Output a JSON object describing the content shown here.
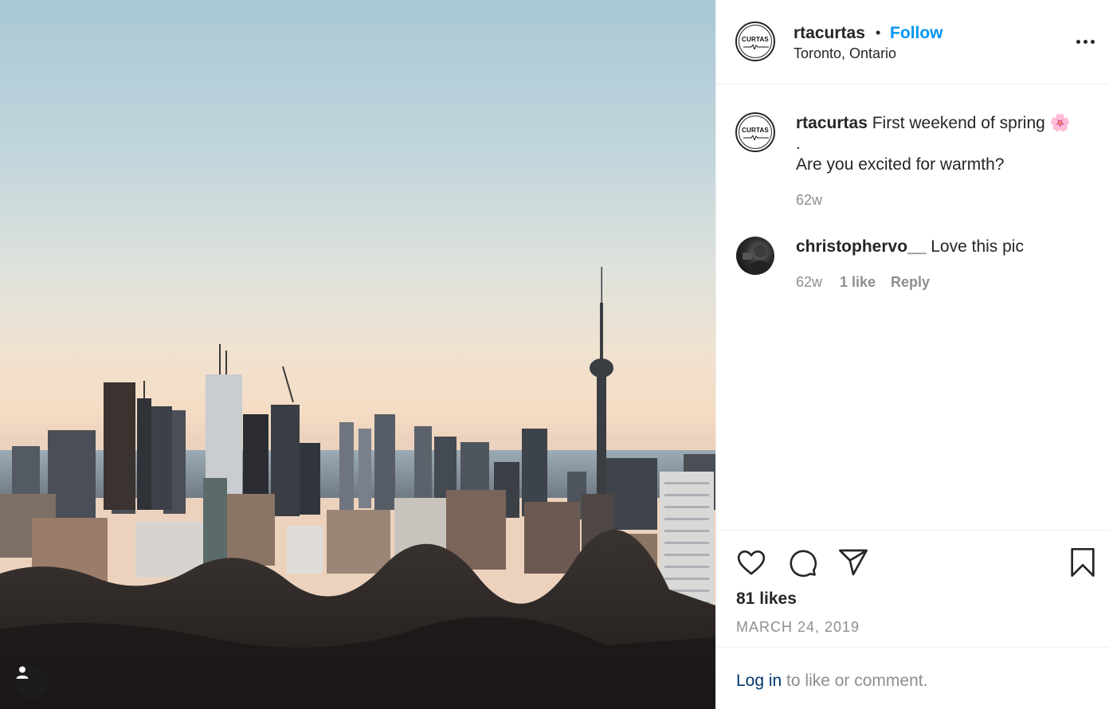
{
  "post": {
    "username": "rtacurtas",
    "separator": "•",
    "follow_label": "Follow",
    "location": "Toronto, Ontario",
    "avatar_word": "CURTAS",
    "caption_line1": "First weekend of spring",
    "caption_emoji": "🌸",
    "caption_line2": ".",
    "caption_line3": "Are you excited for warmth?",
    "caption_time": "62w"
  },
  "comments": [
    {
      "username": "christophervo__",
      "text": "Love this pic",
      "time": "62w",
      "likes": "1 like",
      "reply_label": "Reply"
    }
  ],
  "actions": {
    "icons": [
      "heart-icon",
      "comment-icon",
      "share-icon",
      "bookmark-icon"
    ],
    "likes_label": "81 likes",
    "date": "MARCH 24, 2019"
  },
  "login": {
    "link_label": "Log in",
    "rest": " to like or comment."
  },
  "colors": {
    "link_blue": "#0095f6",
    "login_blue": "#00376b",
    "muted": "#8e8e8e",
    "text": "#262626"
  }
}
